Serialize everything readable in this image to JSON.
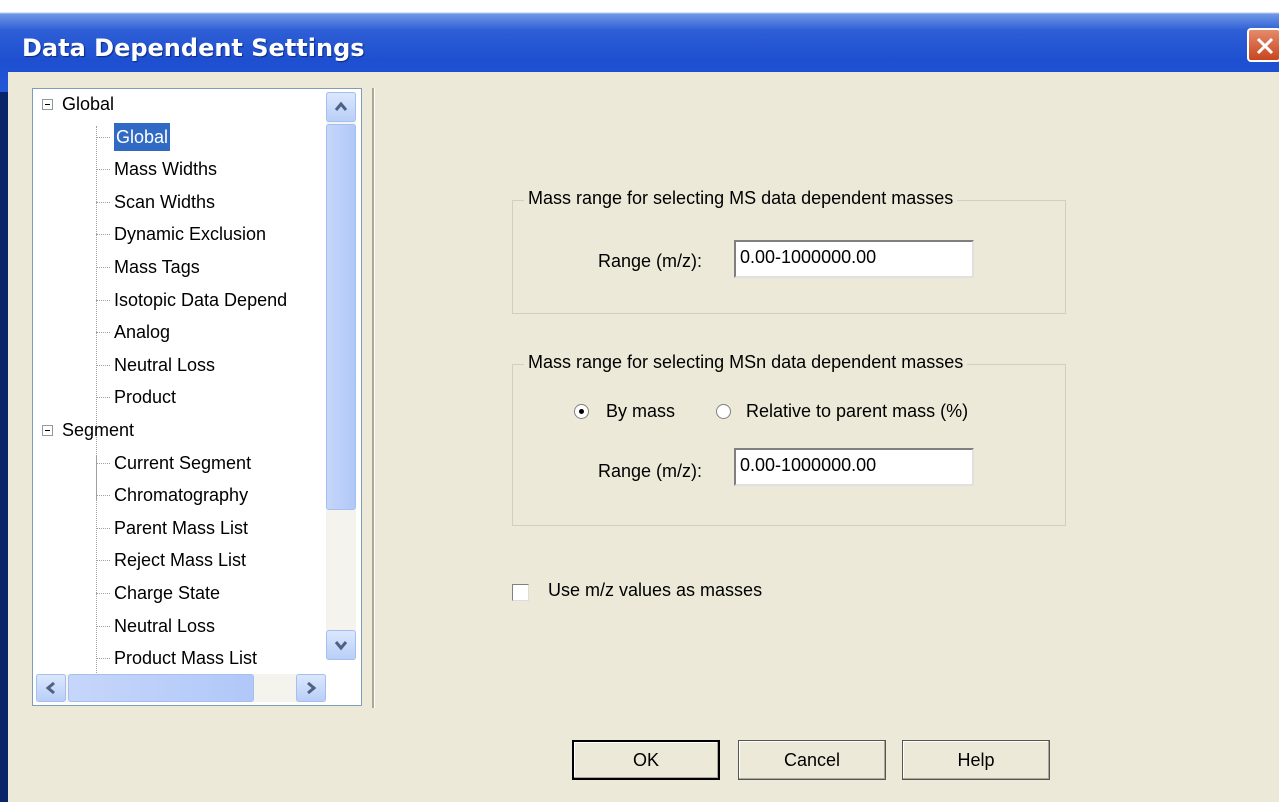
{
  "window": {
    "title": "Data Dependent Settings"
  },
  "tree": {
    "items": [
      {
        "label": "Global",
        "level": 0,
        "expanded": true
      },
      {
        "label": "Global",
        "level": 1,
        "selected": true
      },
      {
        "label": "Mass Widths",
        "level": 1
      },
      {
        "label": "Scan Widths",
        "level": 1
      },
      {
        "label": "Dynamic Exclusion",
        "level": 1
      },
      {
        "label": "Mass Tags",
        "level": 1
      },
      {
        "label": "Isotopic Data Depend",
        "level": 1
      },
      {
        "label": "Analog",
        "level": 1
      },
      {
        "label": "Neutral Loss",
        "level": 1
      },
      {
        "label": "Product",
        "level": 1
      },
      {
        "label": "Segment",
        "level": 0,
        "expanded": true
      },
      {
        "label": "Current Segment",
        "level": 1
      },
      {
        "label": "Chromatography",
        "level": 1
      },
      {
        "label": "Parent Mass List",
        "level": 1
      },
      {
        "label": "Reject Mass List",
        "level": 1
      },
      {
        "label": "Charge State",
        "level": 1
      },
      {
        "label": "Neutral Loss",
        "level": 1
      },
      {
        "label": "Product Mass List",
        "level": 1
      }
    ]
  },
  "ms_group": {
    "legend": "Mass range for selecting MS data dependent masses",
    "range_label": "Range (m/z):",
    "range_value": "0.00-1000000.00"
  },
  "msn_group": {
    "legend": "Mass range for selecting MSn data dependent masses",
    "by_mass_label": "By mass",
    "relative_label": "Relative to parent mass (%)",
    "selected_option": "By mass",
    "range_label": "Range (m/z):",
    "range_value": "0.00-1000000.00"
  },
  "use_mz": {
    "label": "Use m/z values as masses",
    "checked": false
  },
  "buttons": {
    "ok": "OK",
    "cancel": "Cancel",
    "help": "Help"
  }
}
